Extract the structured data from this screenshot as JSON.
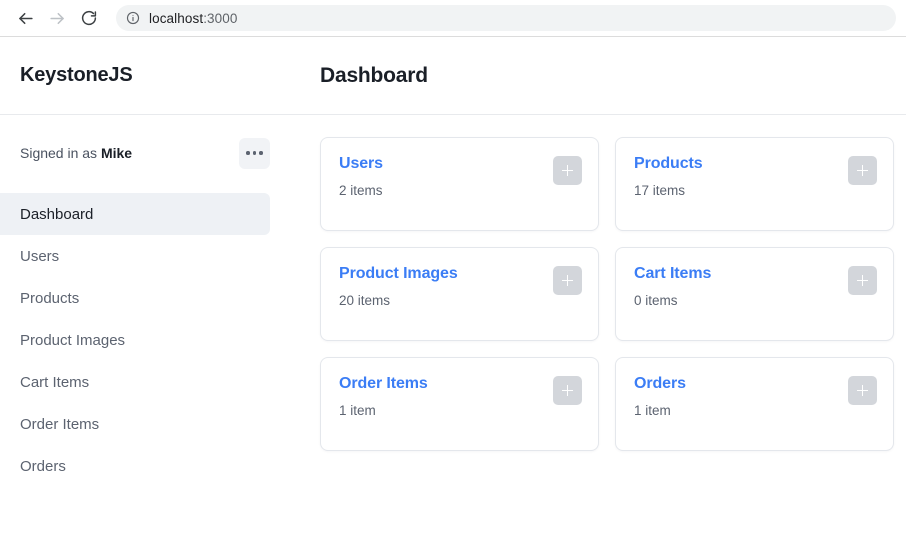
{
  "browser": {
    "back_icon": "arrow-left-icon",
    "forward_icon": "arrow-right-icon",
    "reload_icon": "reload-icon",
    "info_icon": "info-circle-icon",
    "url_host": "localhost",
    "url_port": ":3000",
    "url_full": "localhost:3000"
  },
  "brand": {
    "title": "KeystoneJS"
  },
  "header": {
    "page_title": "Dashboard"
  },
  "sidebar": {
    "signed_in_prefix": "Signed in as ",
    "signed_in_user": "Mike",
    "more_icon": "ellipsis-icon",
    "items": [
      {
        "label": "Dashboard",
        "active": true
      },
      {
        "label": "Users",
        "active": false
      },
      {
        "label": "Products",
        "active": false
      },
      {
        "label": "Product Images",
        "active": false
      },
      {
        "label": "Cart Items",
        "active": false
      },
      {
        "label": "Order Items",
        "active": false
      },
      {
        "label": "Orders",
        "active": false
      }
    ]
  },
  "main": {
    "add_icon": "plus-icon",
    "cards": [
      {
        "title": "Users",
        "count": "2 items"
      },
      {
        "title": "Products",
        "count": "17 items"
      },
      {
        "title": "Product Images",
        "count": "20 items"
      },
      {
        "title": "Cart Items",
        "count": "0 items"
      },
      {
        "title": "Order Items",
        "count": "1 item"
      },
      {
        "title": "Orders",
        "count": "1 item"
      }
    ]
  },
  "colors": {
    "link_blue": "#3b7df5",
    "active_nav_bg": "#eef1f5",
    "add_button_bg": "#d3d6db",
    "text_dark": "#1a1f27",
    "text_muted": "#5c6370"
  }
}
